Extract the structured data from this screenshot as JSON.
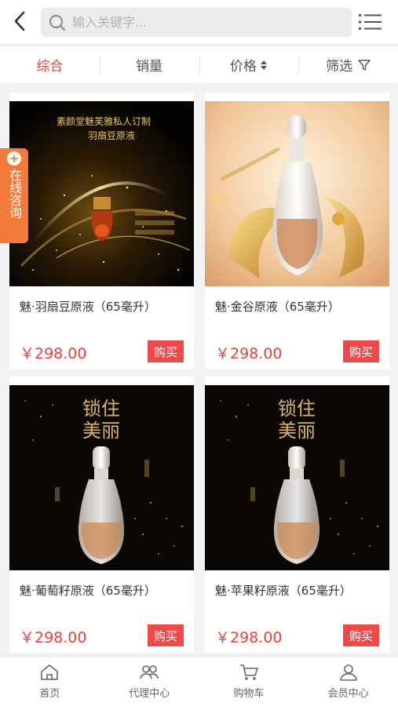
{
  "header": {
    "search_placeholder": "输入关键字..."
  },
  "sort": {
    "items": [
      {
        "label": "综合",
        "active": true,
        "suffix": ""
      },
      {
        "label": "销量",
        "active": false,
        "suffix": ""
      },
      {
        "label": "价格",
        "active": false,
        "suffix": "⇕"
      },
      {
        "label": "筛选",
        "active": false,
        "suffix": "⊽"
      }
    ]
  },
  "consult": {
    "label": "在线咨询"
  },
  "products": [
    {
      "title": "魅·羽扇豆原液（65毫升）",
      "price": "￥298.00",
      "buy": "购买",
      "img_text": [
        "素颜堂魅芙雅私人订制",
        "羽扇豆原液"
      ]
    },
    {
      "title": "魅·金谷原液（65毫升）",
      "price": "￥298.00",
      "buy": "购买",
      "img_text": []
    },
    {
      "title": "魅·葡萄籽原液（65毫升）",
      "price": "￥298.00",
      "buy": "购买",
      "img_text": [
        "锁住",
        "美丽"
      ]
    },
    {
      "title": "魅·苹果籽原液（65毫升）",
      "price": "￥298.00",
      "buy": "购买",
      "img_text": [
        "锁住",
        "美丽"
      ]
    }
  ],
  "nav": {
    "items": [
      {
        "label": "首页",
        "icon": "home-icon"
      },
      {
        "label": "代理中心",
        "icon": "agents-icon"
      },
      {
        "label": "购物车",
        "icon": "cart-icon"
      },
      {
        "label": "会员中心",
        "icon": "member-icon"
      }
    ]
  },
  "colors": {
    "accent": "#e8413a",
    "buy_button": "#ef4a4a",
    "consult": "#f47a3c"
  }
}
